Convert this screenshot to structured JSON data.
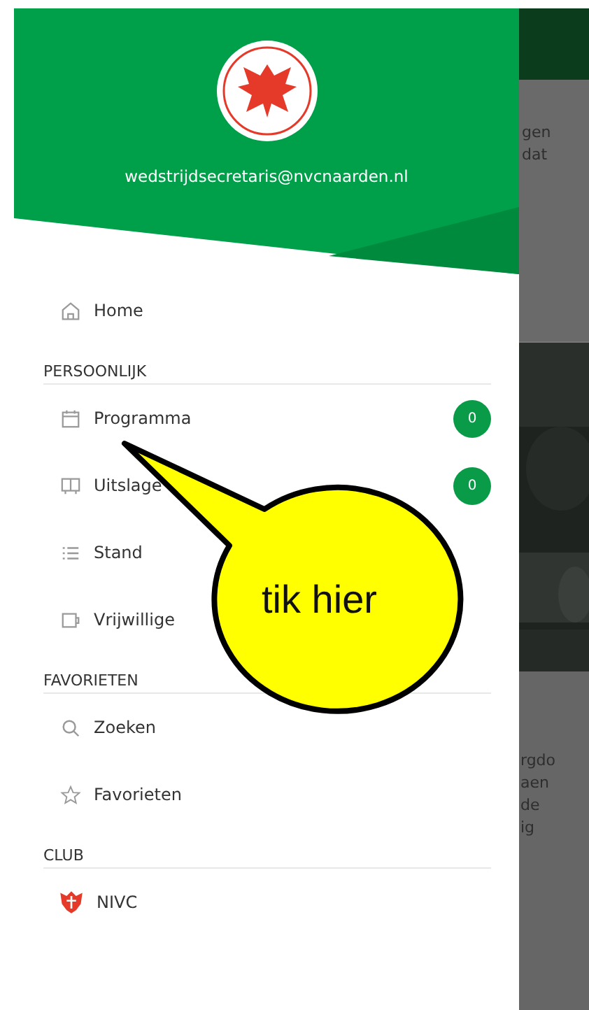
{
  "drawer": {
    "account_email": "wedstrijdsecretaris@nvcnaarden.nl",
    "sections": [
      {
        "items": [
          {
            "label": "Home"
          }
        ]
      },
      {
        "title": "PERSOONLIJK",
        "items": [
          {
            "label": "Programma",
            "badge": "0"
          },
          {
            "label": "Uitslage",
            "badge": "0"
          },
          {
            "label": "Stand"
          },
          {
            "label": "Vrijwillige"
          }
        ]
      },
      {
        "title": "FAVORIETEN",
        "items": [
          {
            "label": "Zoeken"
          },
          {
            "label": "Favorieten"
          }
        ]
      },
      {
        "title": "CLUB",
        "items": [
          {
            "label": "NIVC"
          }
        ]
      }
    ]
  },
  "callout": {
    "text": "tik hier"
  },
  "background": {
    "card_1_lines": [
      "gen",
      "dat"
    ],
    "card_2_lines": [
      "rgdo",
      "aen",
      "de",
      "ig"
    ]
  }
}
